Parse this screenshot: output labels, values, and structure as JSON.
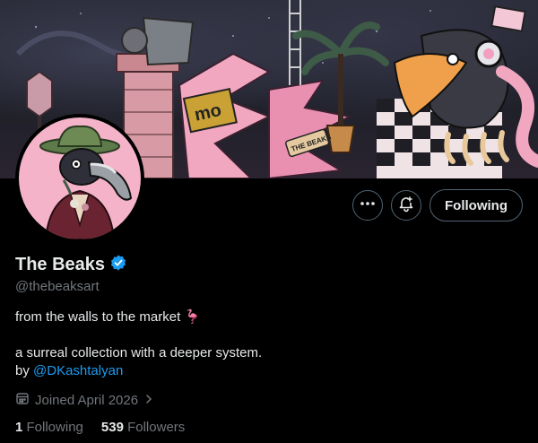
{
  "profile": {
    "name": "The Beaks",
    "handle": "@thebeaksart",
    "bio_line1": "from the walls to the market",
    "bio_emoji": "🦩",
    "bio_line2": "a surreal collection with a deeper system.",
    "bio_by": "by ",
    "bio_link": "@DKashtalyan",
    "joined": "Joined April 2026",
    "following_count": "1",
    "following_label": "Following",
    "followers_count": "539",
    "followers_label": "Followers"
  },
  "actions": {
    "more_icon": "more-horizontal-icon",
    "notify_icon": "bell-plus-icon",
    "follow_label": "Following"
  },
  "banner_sign": "THE BEAKS",
  "banner_logo": "mo",
  "colors": {
    "background": "#000000",
    "text": "#e7e9ea",
    "muted": "#71767b",
    "link": "#1d9bf0",
    "verified": "#1d9bf0",
    "banner_pink": "#f4a8c2"
  }
}
